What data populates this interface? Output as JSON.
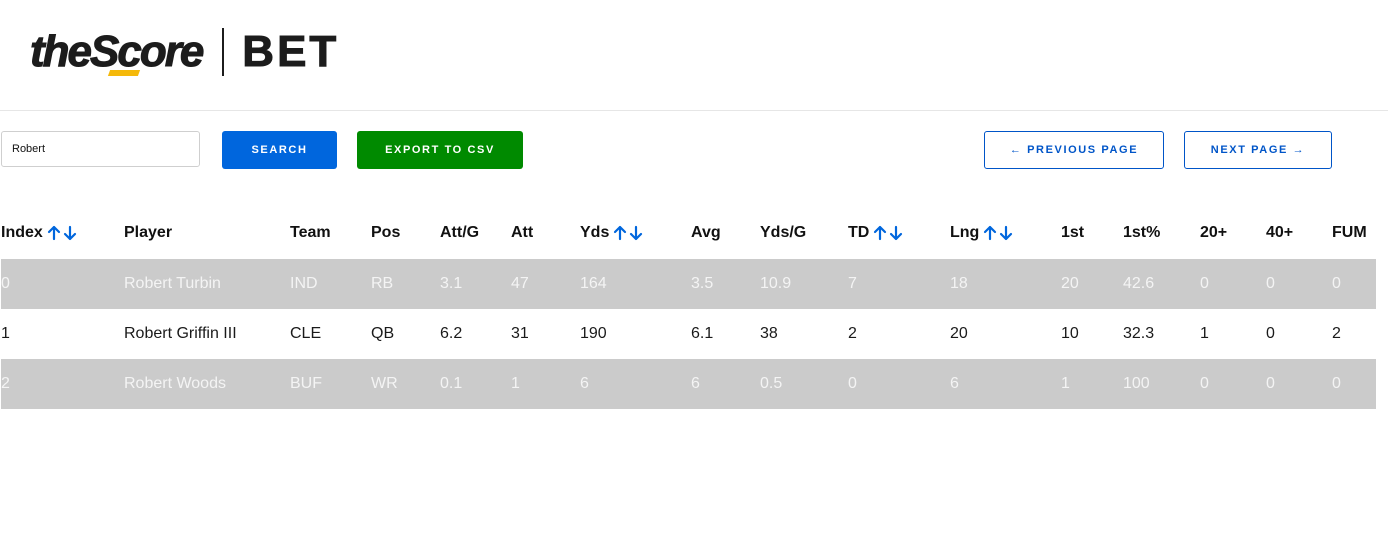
{
  "brand": {
    "logo_score": "theScore",
    "logo_bet": "BET"
  },
  "toolbar": {
    "search_value": "Robert",
    "search_label": "SEARCH",
    "export_label": "EXPORT TO CSV",
    "prev_label": "← PREVIOUS PAGE",
    "next_label": "NEXT PAGE →"
  },
  "colors": {
    "primary_blue": "#0066dd",
    "export_green": "#008a00",
    "logo_accent": "#f5b90a",
    "stripe_gray": "#cbcbcb"
  },
  "table": {
    "columns": [
      {
        "label": "Index",
        "sortable": true
      },
      {
        "label": "Player",
        "sortable": false
      },
      {
        "label": "Team",
        "sortable": false
      },
      {
        "label": "Pos",
        "sortable": false
      },
      {
        "label": "Att/G",
        "sortable": false
      },
      {
        "label": "Att",
        "sortable": false
      },
      {
        "label": "Yds",
        "sortable": true
      },
      {
        "label": "Avg",
        "sortable": false
      },
      {
        "label": "Yds/G",
        "sortable": false
      },
      {
        "label": "TD",
        "sortable": true
      },
      {
        "label": "Lng",
        "sortable": true
      },
      {
        "label": "1st",
        "sortable": false
      },
      {
        "label": "1st%",
        "sortable": false
      },
      {
        "label": "20+",
        "sortable": false
      },
      {
        "label": "40+",
        "sortable": false
      },
      {
        "label": "FUM",
        "sortable": false
      }
    ],
    "rows": [
      [
        "0",
        "Robert Turbin",
        "IND",
        "RB",
        "3.1",
        "47",
        "164",
        "3.5",
        "10.9",
        "7",
        "18",
        "20",
        "42.6",
        "0",
        "0",
        "0"
      ],
      [
        "1",
        "Robert Griffin III",
        "CLE",
        "QB",
        "6.2",
        "31",
        "190",
        "6.1",
        "38",
        "2",
        "20",
        "10",
        "32.3",
        "1",
        "0",
        "2"
      ],
      [
        "2",
        "Robert Woods",
        "BUF",
        "WR",
        "0.1",
        "1",
        "6",
        "6",
        "0.5",
        "0",
        "6",
        "1",
        "100",
        "0",
        "0",
        "0"
      ]
    ]
  }
}
